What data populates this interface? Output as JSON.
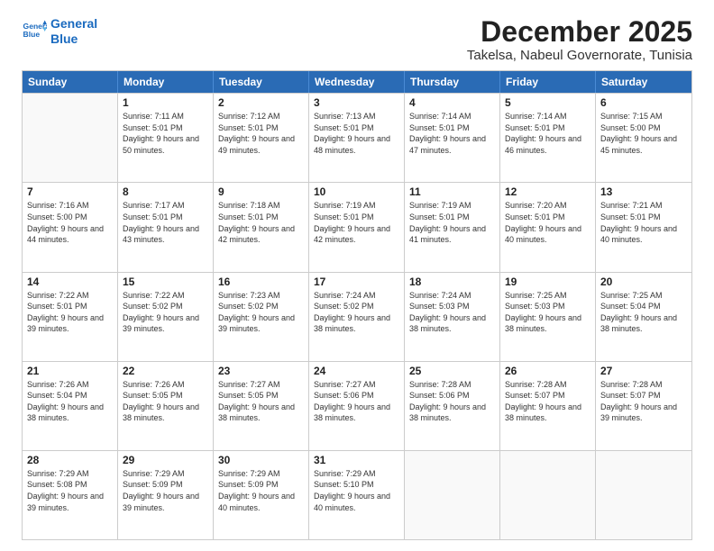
{
  "logo": {
    "line1": "General",
    "line2": "Blue"
  },
  "title": "December 2025",
  "subtitle": "Takelsa, Nabeul Governorate, Tunisia",
  "header": {
    "days": [
      "Sunday",
      "Monday",
      "Tuesday",
      "Wednesday",
      "Thursday",
      "Friday",
      "Saturday"
    ]
  },
  "weeks": [
    [
      {
        "day": "",
        "empty": true
      },
      {
        "day": "1",
        "sunrise": "7:11 AM",
        "sunset": "5:01 PM",
        "daylight": "9 hours and 50 minutes."
      },
      {
        "day": "2",
        "sunrise": "7:12 AM",
        "sunset": "5:01 PM",
        "daylight": "9 hours and 49 minutes."
      },
      {
        "day": "3",
        "sunrise": "7:13 AM",
        "sunset": "5:01 PM",
        "daylight": "9 hours and 48 minutes."
      },
      {
        "day": "4",
        "sunrise": "7:14 AM",
        "sunset": "5:01 PM",
        "daylight": "9 hours and 47 minutes."
      },
      {
        "day": "5",
        "sunrise": "7:14 AM",
        "sunset": "5:01 PM",
        "daylight": "9 hours and 46 minutes."
      },
      {
        "day": "6",
        "sunrise": "7:15 AM",
        "sunset": "5:00 PM",
        "daylight": "9 hours and 45 minutes."
      }
    ],
    [
      {
        "day": "7",
        "sunrise": "7:16 AM",
        "sunset": "5:00 PM",
        "daylight": "9 hours and 44 minutes."
      },
      {
        "day": "8",
        "sunrise": "7:17 AM",
        "sunset": "5:01 PM",
        "daylight": "9 hours and 43 minutes."
      },
      {
        "day": "9",
        "sunrise": "7:18 AM",
        "sunset": "5:01 PM",
        "daylight": "9 hours and 42 minutes."
      },
      {
        "day": "10",
        "sunrise": "7:19 AM",
        "sunset": "5:01 PM",
        "daylight": "9 hours and 42 minutes."
      },
      {
        "day": "11",
        "sunrise": "7:19 AM",
        "sunset": "5:01 PM",
        "daylight": "9 hours and 41 minutes."
      },
      {
        "day": "12",
        "sunrise": "7:20 AM",
        "sunset": "5:01 PM",
        "daylight": "9 hours and 40 minutes."
      },
      {
        "day": "13",
        "sunrise": "7:21 AM",
        "sunset": "5:01 PM",
        "daylight": "9 hours and 40 minutes."
      }
    ],
    [
      {
        "day": "14",
        "sunrise": "7:22 AM",
        "sunset": "5:01 PM",
        "daylight": "9 hours and 39 minutes."
      },
      {
        "day": "15",
        "sunrise": "7:22 AM",
        "sunset": "5:02 PM",
        "daylight": "9 hours and 39 minutes."
      },
      {
        "day": "16",
        "sunrise": "7:23 AM",
        "sunset": "5:02 PM",
        "daylight": "9 hours and 39 minutes."
      },
      {
        "day": "17",
        "sunrise": "7:24 AM",
        "sunset": "5:02 PM",
        "daylight": "9 hours and 38 minutes."
      },
      {
        "day": "18",
        "sunrise": "7:24 AM",
        "sunset": "5:03 PM",
        "daylight": "9 hours and 38 minutes."
      },
      {
        "day": "19",
        "sunrise": "7:25 AM",
        "sunset": "5:03 PM",
        "daylight": "9 hours and 38 minutes."
      },
      {
        "day": "20",
        "sunrise": "7:25 AM",
        "sunset": "5:04 PM",
        "daylight": "9 hours and 38 minutes."
      }
    ],
    [
      {
        "day": "21",
        "sunrise": "7:26 AM",
        "sunset": "5:04 PM",
        "daylight": "9 hours and 38 minutes."
      },
      {
        "day": "22",
        "sunrise": "7:26 AM",
        "sunset": "5:05 PM",
        "daylight": "9 hours and 38 minutes."
      },
      {
        "day": "23",
        "sunrise": "7:27 AM",
        "sunset": "5:05 PM",
        "daylight": "9 hours and 38 minutes."
      },
      {
        "day": "24",
        "sunrise": "7:27 AM",
        "sunset": "5:06 PM",
        "daylight": "9 hours and 38 minutes."
      },
      {
        "day": "25",
        "sunrise": "7:28 AM",
        "sunset": "5:06 PM",
        "daylight": "9 hours and 38 minutes."
      },
      {
        "day": "26",
        "sunrise": "7:28 AM",
        "sunset": "5:07 PM",
        "daylight": "9 hours and 38 minutes."
      },
      {
        "day": "27",
        "sunrise": "7:28 AM",
        "sunset": "5:07 PM",
        "daylight": "9 hours and 39 minutes."
      }
    ],
    [
      {
        "day": "28",
        "sunrise": "7:29 AM",
        "sunset": "5:08 PM",
        "daylight": "9 hours and 39 minutes."
      },
      {
        "day": "29",
        "sunrise": "7:29 AM",
        "sunset": "5:09 PM",
        "daylight": "9 hours and 39 minutes."
      },
      {
        "day": "30",
        "sunrise": "7:29 AM",
        "sunset": "5:09 PM",
        "daylight": "9 hours and 40 minutes."
      },
      {
        "day": "31",
        "sunrise": "7:29 AM",
        "sunset": "5:10 PM",
        "daylight": "9 hours and 40 minutes."
      },
      {
        "day": "",
        "empty": true
      },
      {
        "day": "",
        "empty": true
      },
      {
        "day": "",
        "empty": true
      }
    ]
  ]
}
